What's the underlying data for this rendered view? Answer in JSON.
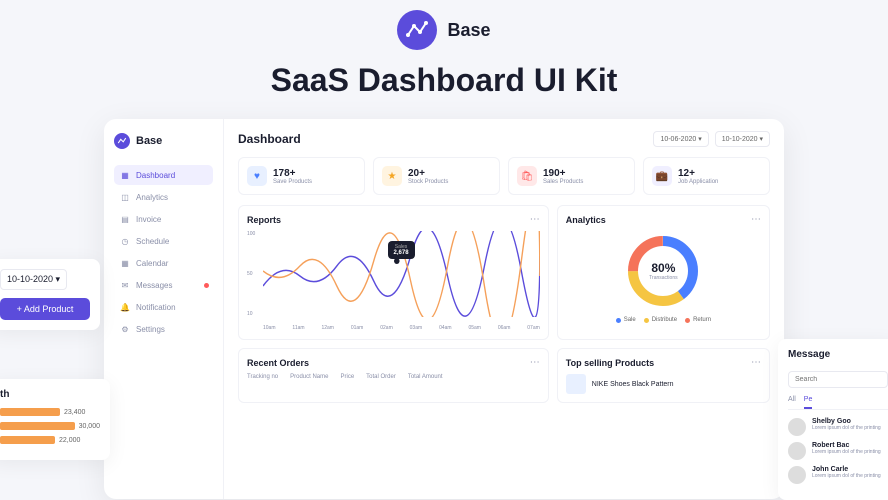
{
  "hero": {
    "brand": "Base",
    "title": "SaaS Dashboard UI Kit"
  },
  "left_peek": {
    "date": "10-10-2020",
    "add_btn": "+ Add Product"
  },
  "month_chart": {
    "title": "th",
    "bars": [
      {
        "value": 23400,
        "label": "23,400",
        "width": 60
      },
      {
        "value": 30000,
        "label": "30,000",
        "width": 80
      },
      {
        "value": 22000,
        "label": "22,000",
        "width": 55
      }
    ]
  },
  "sidebar": {
    "brand": "Base",
    "items": [
      {
        "label": "Dashboard",
        "icon": "grid",
        "active": true
      },
      {
        "label": "Analytics",
        "icon": "chart"
      },
      {
        "label": "Invoice",
        "icon": "file"
      },
      {
        "label": "Schedule",
        "icon": "calendar"
      },
      {
        "label": "Calendar",
        "icon": "calendar"
      },
      {
        "label": "Messages",
        "icon": "mail",
        "badge": true
      },
      {
        "label": "Notification",
        "icon": "bell"
      },
      {
        "label": "Settings",
        "icon": "gear"
      }
    ]
  },
  "header": {
    "title": "Dashboard",
    "date_from": "10-06-2020",
    "date_to": "10-10-2020"
  },
  "stats": [
    {
      "num": "178+",
      "label": "Save Products",
      "color": "blue",
      "glyph": "♥"
    },
    {
      "num": "20+",
      "label": "Stock Products",
      "color": "yellow",
      "glyph": "★"
    },
    {
      "num": "190+",
      "label": "Sales Products",
      "color": "red",
      "glyph": "🛍"
    },
    {
      "num": "12+",
      "label": "Job Application",
      "color": "purple",
      "glyph": "💼"
    }
  ],
  "reports": {
    "title": "Reports",
    "tooltip": {
      "label": "Sales",
      "value": "2,678"
    },
    "yticks": [
      "100",
      "50",
      "10"
    ],
    "xticks": [
      "10am",
      "11am",
      "12am",
      "01am",
      "02am",
      "03am",
      "04am",
      "05am",
      "06am",
      "07am"
    ]
  },
  "analytics": {
    "title": "Analytics",
    "percent": "80%",
    "percent_label": "Transactions",
    "legend": [
      {
        "label": "Sale",
        "color": "#4a7fff"
      },
      {
        "label": "Distribute",
        "color": "#f5c542"
      },
      {
        "label": "Return",
        "color": "#f5735a"
      }
    ]
  },
  "orders": {
    "title": "Recent Orders",
    "cols": [
      "Tracking no",
      "Product Name",
      "Price",
      "Total Order",
      "Total Amount"
    ]
  },
  "top": {
    "title": "Top selling Products",
    "items": [
      {
        "name": "NIKE Shoes Black Pattern"
      }
    ]
  },
  "messages": {
    "title": "Message",
    "search_placeholder": "Search",
    "tabs": [
      "All",
      "Pe"
    ],
    "items": [
      {
        "name": "Shelby Goo",
        "text": "Lorem ipsum dol of the printing"
      },
      {
        "name": "Robert Bac",
        "text": "Lorem ipsum dol of the printing"
      },
      {
        "name": "John Carle",
        "text": "Lorem ipsum dol of the printing"
      }
    ]
  },
  "chart_data": {
    "reports_line": {
      "type": "line",
      "title": "Reports",
      "xlabel": "",
      "ylabel": "",
      "ylim": [
        10,
        100
      ],
      "categories": [
        "10am",
        "11am",
        "12am",
        "01am",
        "02am",
        "03am",
        "04am",
        "05am",
        "06am",
        "07am"
      ],
      "series": [
        {
          "name": "purple",
          "values": [
            40,
            55,
            35,
            60,
            45,
            70,
            50,
            65,
            55,
            75
          ]
        },
        {
          "name": "orange",
          "values": [
            50,
            35,
            55,
            40,
            65,
            50,
            60,
            45,
            70,
            60
          ]
        }
      ],
      "annotation": {
        "x": "02am",
        "label": "Sales",
        "value": 2678
      }
    },
    "analytics_donut": {
      "type": "pie",
      "title": "Analytics",
      "center_label": "80% Transactions",
      "series": [
        {
          "name": "Sale",
          "value": 40,
          "color": "#4a7fff"
        },
        {
          "name": "Distribute",
          "value": 35,
          "color": "#f5c542"
        },
        {
          "name": "Return",
          "value": 25,
          "color": "#f5735a"
        }
      ]
    },
    "month_bars": {
      "type": "bar",
      "categories": [
        "",
        "",
        ""
      ],
      "values": [
        23400,
        30000,
        22000
      ]
    }
  }
}
